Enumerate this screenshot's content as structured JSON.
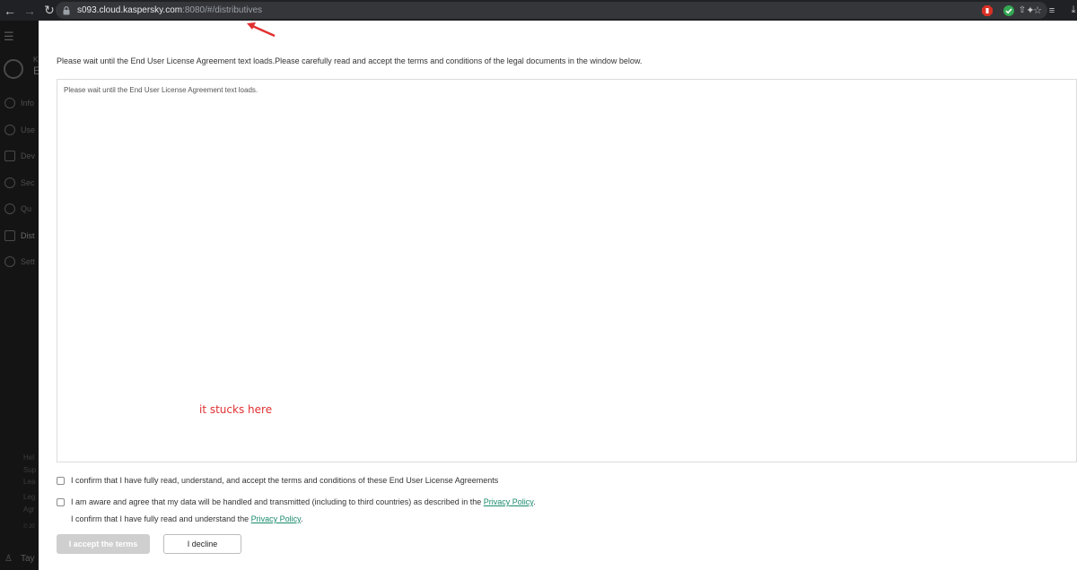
{
  "browser": {
    "url_host": "s093.cloud.kaspersky.com",
    "url_rest": ":8080/#/distributives",
    "back_icon": "arrow-left-icon",
    "forward_icon": "arrow-right-icon",
    "reload_icon": "reload-icon"
  },
  "sidebar": {
    "logo_line1": "K",
    "logo_line2": "E",
    "items": [
      {
        "label": "Info",
        "icon": "info-icon"
      },
      {
        "label": "Use",
        "icon": "user-icon"
      },
      {
        "label": "Dev",
        "icon": "devices-icon"
      },
      {
        "label": "Sec",
        "icon": "security-icon"
      },
      {
        "label": "Qu",
        "icon": "quarantine-icon"
      },
      {
        "label": "Dist",
        "icon": "distributives-icon"
      },
      {
        "label": "Sett",
        "icon": "settings-icon"
      }
    ],
    "footer": [
      "Hel",
      "Sup",
      "Lea",
      "Leg",
      "Agr",
      "© 20"
    ],
    "user_label": "Tay"
  },
  "dialog": {
    "intro": "Please wait until the End User License Agreement text loads.Please carefully read and accept the terms and conditions of the legal documents in the window below.",
    "eula_placeholder": "Please wait until the End User License Agreement text loads.",
    "confirm_eula": "I confirm that I have fully read, understand, and accept the terms and conditions of these End User License Agreements",
    "data_agree_prefix": "I am aware and agree that my data will be handled and transmitted (including to third countries) as described in the ",
    "privacy_link": "Privacy Policy",
    "data_agree_suffix": ".",
    "privacy_confirm_prefix": "I confirm that I have fully read and understand the ",
    "privacy_confirm_suffix": ".",
    "accept_label": "I accept the terms",
    "decline_label": "I decline"
  },
  "annotation": {
    "text": "it stucks here",
    "color": "#e03030"
  },
  "colors": {
    "link": "#1a8a6e",
    "accept_disabled": "#cfcfcf",
    "browser_bar": "#202124"
  }
}
